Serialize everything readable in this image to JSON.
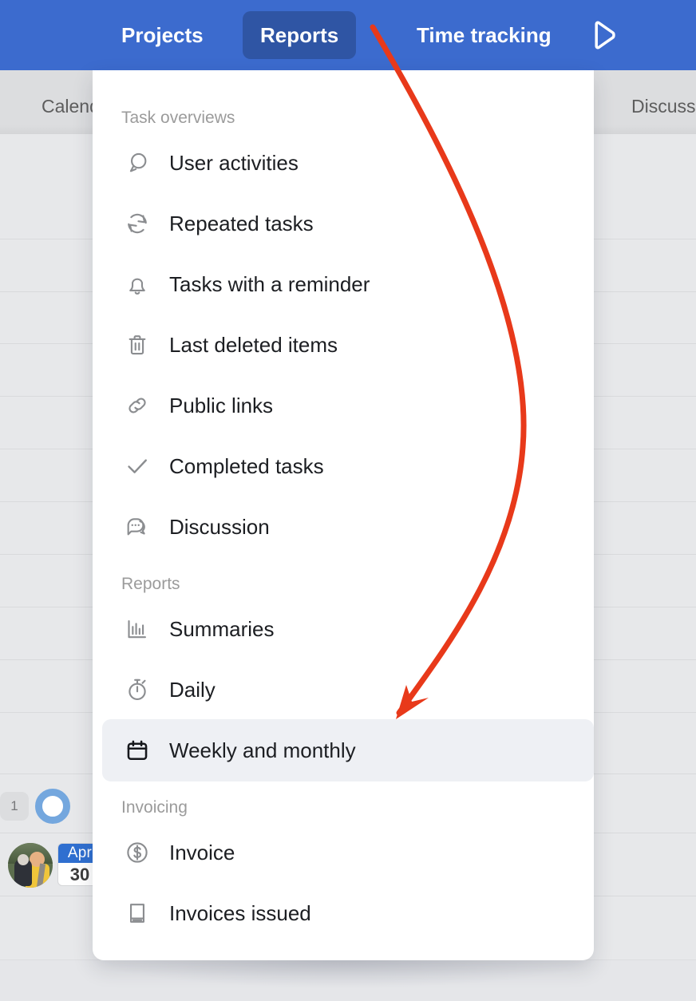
{
  "navbar": {
    "items": [
      {
        "label": "Projects",
        "active": false
      },
      {
        "label": "Reports",
        "active": true
      },
      {
        "label": "Time tracking",
        "active": false
      }
    ],
    "play_icon": "play-icon",
    "background_color": "#3c6bce",
    "active_tab_color": "#2f55a4"
  },
  "background": {
    "column_left_label": "Calendar",
    "column_right_label": "Discussion",
    "badge_count": "1",
    "date_chip": {
      "month": "Apr",
      "day": "30"
    },
    "avatar": "user-avatar"
  },
  "dropdown": {
    "sections": [
      {
        "title": "Task overviews",
        "items": [
          {
            "label": "User activities",
            "icon": "user-activity-icon",
            "selected": false
          },
          {
            "label": "Repeated tasks",
            "icon": "refresh-icon",
            "selected": false
          },
          {
            "label": "Tasks with a reminder",
            "icon": "bell-icon",
            "selected": false
          },
          {
            "label": "Last deleted items",
            "icon": "trash-icon",
            "selected": false
          },
          {
            "label": "Public links",
            "icon": "link-icon",
            "selected": false
          },
          {
            "label": "Completed tasks",
            "icon": "check-icon",
            "selected": false
          },
          {
            "label": "Discussion",
            "icon": "chat-icon",
            "selected": false
          }
        ]
      },
      {
        "title": "Reports",
        "items": [
          {
            "label": "Summaries",
            "icon": "bar-chart-icon",
            "selected": false
          },
          {
            "label": "Daily",
            "icon": "stopwatch-icon",
            "selected": false
          },
          {
            "label": "Weekly and monthly",
            "icon": "calendar-icon",
            "selected": true
          }
        ]
      },
      {
        "title": "Invoicing",
        "items": [
          {
            "label": "Invoice",
            "icon": "dollar-circle-icon",
            "selected": false
          },
          {
            "label": "Invoices issued",
            "icon": "book-icon",
            "selected": false
          }
        ]
      }
    ],
    "highlight_color": "#eef0f4"
  },
  "annotation": {
    "type": "curved-arrow",
    "color": "#e8391a",
    "from": "Reports",
    "to": "Weekly and monthly"
  }
}
